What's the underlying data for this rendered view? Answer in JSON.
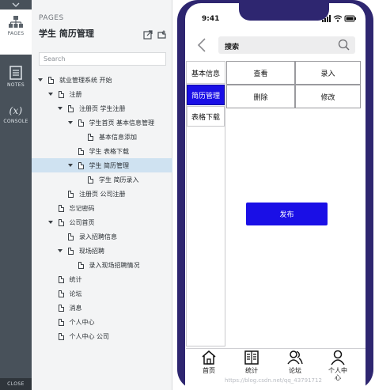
{
  "rail": {
    "pages_label": "PAGES",
    "notes_label": "NOTES",
    "console_glyph": "(x)",
    "console_label": "CONSOLE",
    "close_label": "CLOSE"
  },
  "panel": {
    "label": "PAGES",
    "title": "学生 简历管理",
    "search_placeholder": "Search",
    "tree": [
      {
        "label": "就业管理系统 开始",
        "depth": 0,
        "expanded": true
      },
      {
        "label": "注册",
        "depth": 1,
        "expanded": true
      },
      {
        "label": "注册页 学生注册",
        "depth": 2,
        "expanded": true
      },
      {
        "label": "学生首页 基本信息管理",
        "depth": 3,
        "expanded": true
      },
      {
        "label": "基本信息添加",
        "depth": 4,
        "expanded": false
      },
      {
        "label": "学生 表格下载",
        "depth": 3,
        "expanded": false
      },
      {
        "label": "学生 简历管理",
        "depth": 3,
        "expanded": true,
        "selected": true
      },
      {
        "label": "学生 简历录入",
        "depth": 4,
        "expanded": false
      },
      {
        "label": "注册页 公司注册",
        "depth": 2,
        "expanded": false
      },
      {
        "label": "忘记密码",
        "depth": 1,
        "expanded": false
      },
      {
        "label": "公司首页",
        "depth": 1,
        "expanded": true
      },
      {
        "label": "录入招聘信息",
        "depth": 2,
        "expanded": false
      },
      {
        "label": "现场招聘",
        "depth": 2,
        "expanded": true
      },
      {
        "label": "录入现场招聘情况",
        "depth": 3,
        "expanded": false
      },
      {
        "label": "统计",
        "depth": 1,
        "expanded": false
      },
      {
        "label": "论坛",
        "depth": 1,
        "expanded": false
      },
      {
        "label": "消息",
        "depth": 1,
        "expanded": false
      },
      {
        "label": "个人中心",
        "depth": 1,
        "expanded": false
      },
      {
        "label": "个人中心 公司",
        "depth": 1,
        "expanded": false
      }
    ]
  },
  "phone": {
    "time": "9:41",
    "search_text": "搜索",
    "side_tabs": [
      "基本信息",
      "简历管理",
      "表格下载"
    ],
    "active_side_tab": "简历管理",
    "actions": [
      "查看",
      "录入",
      "删除",
      "修改"
    ],
    "publish_label": "发布",
    "tabbar": [
      {
        "label": "首页",
        "icon": "home-icon"
      },
      {
        "label": "统计",
        "icon": "book-icon"
      },
      {
        "label": "论坛",
        "icon": "users-icon"
      },
      {
        "label": "个人中心",
        "icon": "person-icon"
      }
    ],
    "accent_color": "#1a0fe6",
    "frame_color": "#2e2670"
  },
  "watermark": "https://blog.csdn.net/qq_43791712"
}
